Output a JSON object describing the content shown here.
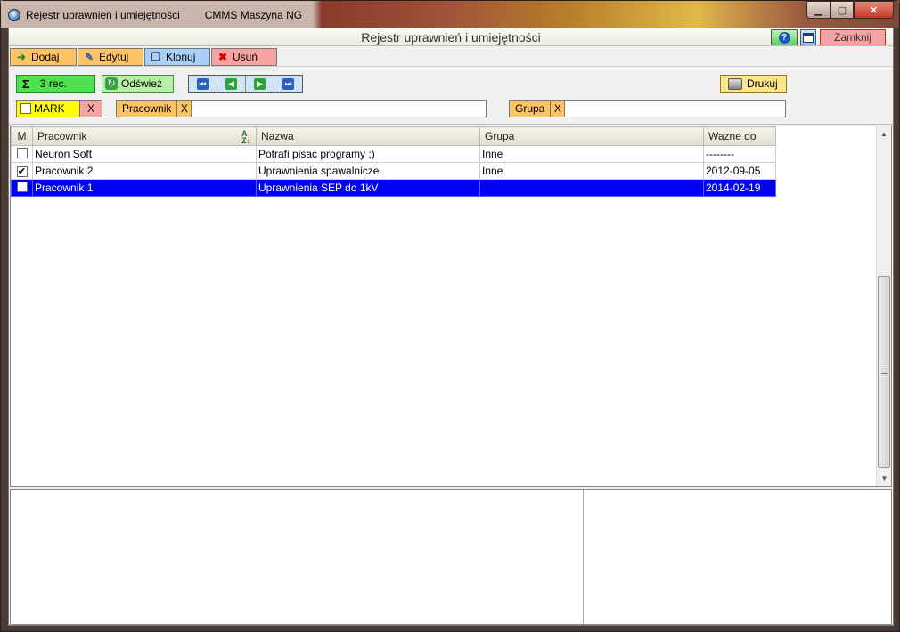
{
  "window": {
    "title": "Rejestr uprawnień i umiejętności",
    "app_name": "CMMS Maszyna NG"
  },
  "header": {
    "title": "Rejestr uprawnień i umiejętności",
    "help_label": "?",
    "close_label": "Zamknij"
  },
  "toolbar": {
    "add_label": "Dodaj",
    "edit_label": "Edytuj",
    "clone_label": "Klonuj",
    "delete_label": "Usuń"
  },
  "controls": {
    "records_sigma": "Σ",
    "records_label": "3 rec.",
    "refresh_label": "Odśwież",
    "print_label": "Drukuj"
  },
  "filters": {
    "mark_label": "MARK",
    "mark_clear": "X",
    "employee_label": "Pracownik",
    "employee_clear": "X",
    "employee_value": "",
    "group_label": "Grupa",
    "group_clear": "X",
    "group_value": ""
  },
  "grid": {
    "columns": [
      "M",
      "Pracownik",
      "Nazwa",
      "Grupa",
      "Wazne do"
    ],
    "sort_indicator": "AZ",
    "rows": [
      {
        "checked": false,
        "pracownik": "Neuron Soft",
        "nazwa": "Potrafi pisać programy ;)",
        "grupa": "Inne",
        "wazne_do": "--------"
      },
      {
        "checked": true,
        "pracownik": "Pracownik 2",
        "nazwa": "Uprawnienia spawalnicze",
        "grupa": "Inne",
        "wazne_do": "2012-09-05"
      },
      {
        "checked": false,
        "pracownik": "Pracownik 1",
        "nazwa": "Uprawnienia SEP do 1kV",
        "grupa": "",
        "wazne_do": "2014-02-19"
      }
    ],
    "selected_row": 2
  },
  "colors": {
    "selection": "#0000f5",
    "add_edit": "#fcc464",
    "clone": "#a8cff6",
    "delete": "#f7a3a3",
    "records": "#4fe04f",
    "mark": "#ffff00"
  }
}
